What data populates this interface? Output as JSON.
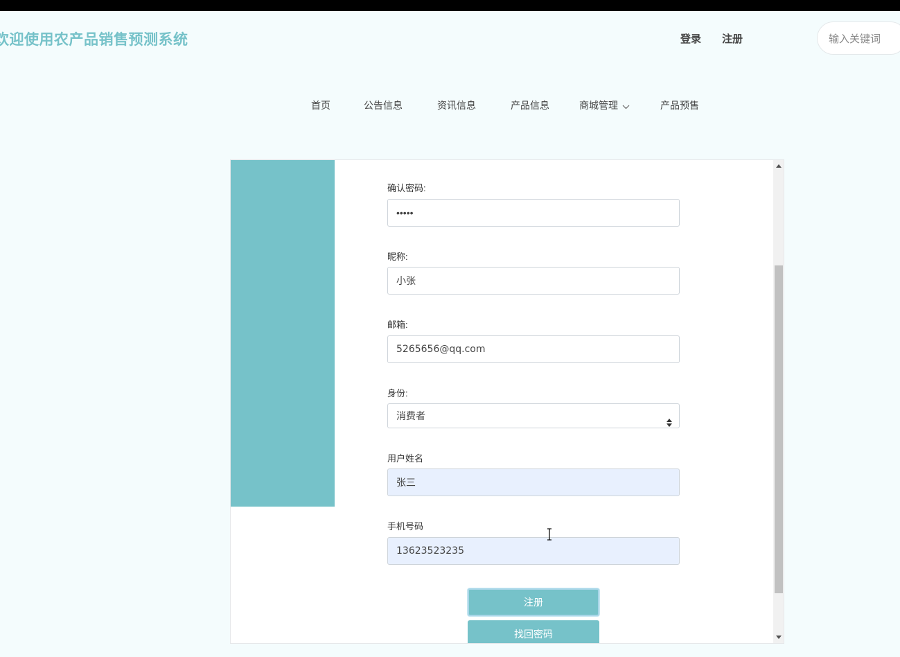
{
  "header": {
    "site_title": "欢迎使用农产品销售预测系统",
    "login_label": "登录",
    "register_label": "注册",
    "search_placeholder": "输入关键词"
  },
  "nav": {
    "items": [
      {
        "label": "首页"
      },
      {
        "label": "公告信息"
      },
      {
        "label": "资讯信息"
      },
      {
        "label": "产品信息"
      },
      {
        "label": "商城管理"
      },
      {
        "label": "产品预售"
      }
    ]
  },
  "form": {
    "confirm_password": {
      "label": "确认密码:",
      "value": "•••••"
    },
    "nickname": {
      "label": "昵称:",
      "value": "小张"
    },
    "email": {
      "label": "邮箱:",
      "value": "5265656@qq.com"
    },
    "role": {
      "label": "身份:",
      "selected": "消费者"
    },
    "username": {
      "label": "用户姓名",
      "value": "张三"
    },
    "phone": {
      "label": "手机号码",
      "value": "13623523235"
    },
    "register_button": "注册",
    "recover_button": "找回密码"
  },
  "colors": {
    "accent": "#76c2c9",
    "page_background": "#f4fcfd",
    "autofill_background": "#e8f0fe"
  },
  "icons": {
    "dropdown": "chevron-down-icon",
    "select": "select-arrows-icon",
    "cursor": "text-cursor-icon"
  }
}
